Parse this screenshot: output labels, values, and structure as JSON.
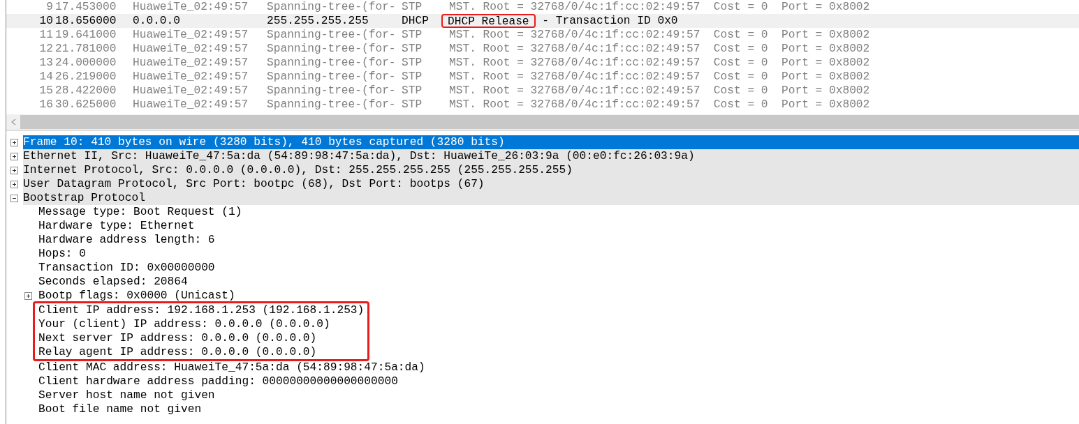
{
  "packets": [
    {
      "no": "9",
      "time": "17.453000",
      "source": "HuaweiTe_02:49:57",
      "destination": "Spanning-tree-(for-",
      "protocol": "STP",
      "info": "MST. Root = 32768/0/4c:1f:cc:02:49:57  Cost = 0  Port = 0x8002",
      "selected": false
    },
    {
      "no": "10",
      "time": "18.656000",
      "source": "0.0.0.0",
      "destination": "255.255.255.255",
      "protocol": "DHCP",
      "info_boxed": "DHCP Release",
      "info": " - Transaction ID 0x0",
      "selected": true
    },
    {
      "no": "11",
      "time": "19.641000",
      "source": "HuaweiTe_02:49:57",
      "destination": "Spanning-tree-(for-",
      "protocol": "STP",
      "info": "MST. Root = 32768/0/4c:1f:cc:02:49:57  Cost = 0  Port = 0x8002",
      "selected": false
    },
    {
      "no": "12",
      "time": "21.781000",
      "source": "HuaweiTe_02:49:57",
      "destination": "Spanning-tree-(for-",
      "protocol": "STP",
      "info": "MST. Root = 32768/0/4c:1f:cc:02:49:57  Cost = 0  Port = 0x8002",
      "selected": false
    },
    {
      "no": "13",
      "time": "24.000000",
      "source": "HuaweiTe_02:49:57",
      "destination": "Spanning-tree-(for-",
      "protocol": "STP",
      "info": "MST. Root = 32768/0/4c:1f:cc:02:49:57  Cost = 0  Port = 0x8002",
      "selected": false
    },
    {
      "no": "14",
      "time": "26.219000",
      "source": "HuaweiTe_02:49:57",
      "destination": "Spanning-tree-(for-",
      "protocol": "STP",
      "info": "MST. Root = 32768/0/4c:1f:cc:02:49:57  Cost = 0  Port = 0x8002",
      "selected": false
    },
    {
      "no": "15",
      "time": "28.422000",
      "source": "HuaweiTe_02:49:57",
      "destination": "Spanning-tree-(for-",
      "protocol": "STP",
      "info": "MST. Root = 32768/0/4c:1f:cc:02:49:57  Cost = 0  Port = 0x8002",
      "selected": false
    },
    {
      "no": "16",
      "time": "30.625000",
      "source": "HuaweiTe_02:49:57",
      "destination": "Spanning-tree-(for-",
      "protocol": "STP",
      "info": "MST. Root = 32768/0/4c:1f:cc:02:49:57  Cost = 0  Port = 0x8002",
      "selected": false
    }
  ],
  "details": [
    {
      "label": "Frame 10: 410 bytes on wire (3280 bits), 410 bytes captured (3280 bits)",
      "kind": "node",
      "expanded": false,
      "selected": true
    },
    {
      "label": "Ethernet II, Src: HuaweiTe_47:5a:da (54:89:98:47:5a:da), Dst: HuaweiTe_26:03:9a (00:e0:fc:26:03:9a)",
      "kind": "node",
      "expanded": false,
      "selected": false
    },
    {
      "label": "Internet Protocol, Src: 0.0.0.0 (0.0.0.0), Dst: 255.255.255.255 (255.255.255.255)",
      "kind": "node",
      "expanded": false,
      "selected": false
    },
    {
      "label": "User Datagram Protocol, Src Port: bootpc (68), Dst Port: bootps (67)",
      "kind": "node",
      "expanded": false,
      "selected": false
    },
    {
      "label": "Bootstrap Protocol",
      "kind": "node",
      "expanded": true,
      "selected": false,
      "children": [
        {
          "label": "Message type: Boot Request (1)",
          "kind": "leaf",
          "selected": false,
          "boxed": false
        },
        {
          "label": "Hardware type: Ethernet",
          "kind": "leaf",
          "selected": false,
          "boxed": false
        },
        {
          "label": "Hardware address length: 6",
          "kind": "leaf",
          "selected": false,
          "boxed": false
        },
        {
          "label": "Hops: 0",
          "kind": "leaf",
          "selected": false,
          "boxed": false
        },
        {
          "label": "Transaction ID: 0x00000000",
          "kind": "leaf",
          "selected": false,
          "boxed": false
        },
        {
          "label": "Seconds elapsed: 20864",
          "kind": "leaf",
          "selected": false,
          "boxed": false
        },
        {
          "label": "Bootp flags: 0x0000 (Unicast)",
          "kind": "node",
          "expanded": false,
          "selected": false,
          "boxed": false
        },
        {
          "label": "Client IP address: 192.168.1.253 (192.168.1.253)",
          "kind": "leaf",
          "selected": false,
          "boxed": true
        },
        {
          "label": "Your (client) IP address: 0.0.0.0 (0.0.0.0)",
          "kind": "leaf",
          "selected": false,
          "boxed": true
        },
        {
          "label": "Next server IP address: 0.0.0.0 (0.0.0.0)",
          "kind": "leaf",
          "selected": false,
          "boxed": true
        },
        {
          "label": "Relay agent IP address: 0.0.0.0 (0.0.0.0)",
          "kind": "leaf",
          "selected": false,
          "boxed": true
        },
        {
          "label": "Client MAC address: HuaweiTe_47:5a:da (54:89:98:47:5a:da)",
          "kind": "leaf",
          "selected": false,
          "boxed": false
        },
        {
          "label": "Client hardware address padding: 00000000000000000000",
          "kind": "leaf",
          "selected": false,
          "boxed": false
        },
        {
          "label": "Server host name not given",
          "kind": "leaf",
          "selected": false,
          "boxed": false
        },
        {
          "label": "Boot file name not given",
          "kind": "leaf",
          "selected": false,
          "boxed": false
        }
      ]
    }
  ]
}
